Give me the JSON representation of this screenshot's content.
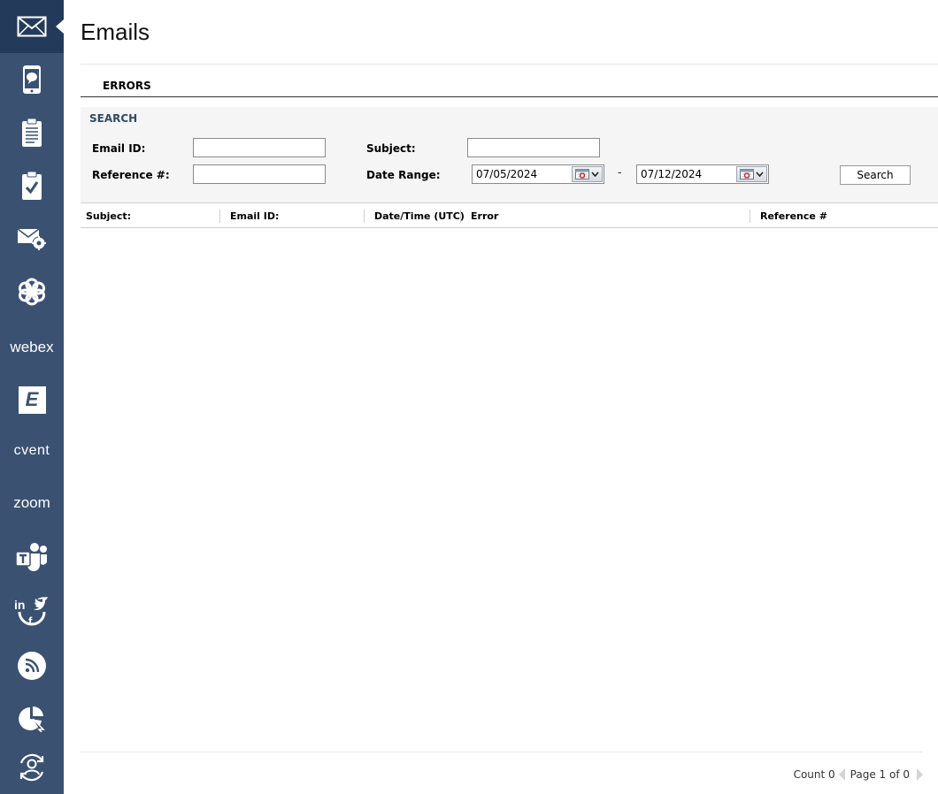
{
  "sidebar": {
    "items": [
      {
        "name": "email-envelope-icon",
        "active": true
      },
      {
        "name": "mobile-chat-icon"
      },
      {
        "name": "clipboard-list-icon"
      },
      {
        "name": "clipboard-check-icon"
      },
      {
        "name": "email-settings-icon"
      },
      {
        "name": "flower-icon"
      },
      {
        "name": "webex-logo",
        "label": "webex"
      },
      {
        "name": "eloqua-icon",
        "label": "E"
      },
      {
        "name": "cvent-logo",
        "label": "cvent"
      },
      {
        "name": "zoom-logo",
        "label": "zoom"
      },
      {
        "name": "teams-icon"
      },
      {
        "name": "social-icon"
      },
      {
        "name": "rss-icon"
      },
      {
        "name": "pie-cursor-icon"
      },
      {
        "name": "user-sync-icon"
      }
    ]
  },
  "page": {
    "title": "Emails"
  },
  "tabs": {
    "errors": "ERRORS"
  },
  "search": {
    "heading": "SEARCH",
    "email_id_label": "Email ID:",
    "email_id_value": "",
    "subject_label": "Subject:",
    "subject_value": "",
    "reference_label": "Reference #:",
    "reference_value": "",
    "date_range_label": "Date Range:",
    "date_from": "07/05/2024",
    "date_separator": "-",
    "date_to": "07/12/2024",
    "search_button": "Search"
  },
  "grid": {
    "columns": [
      "Subject:",
      "Email ID:",
      "Date/Time (UTC)",
      "Error",
      "Reference #"
    ],
    "rows": []
  },
  "footer": {
    "count": "Count 0",
    "page": "Page 1 of 0"
  },
  "colors": {
    "sidebar": "#3a5172",
    "sidebar_active": "#243a5a",
    "search_heading": "#2f4a6a"
  }
}
